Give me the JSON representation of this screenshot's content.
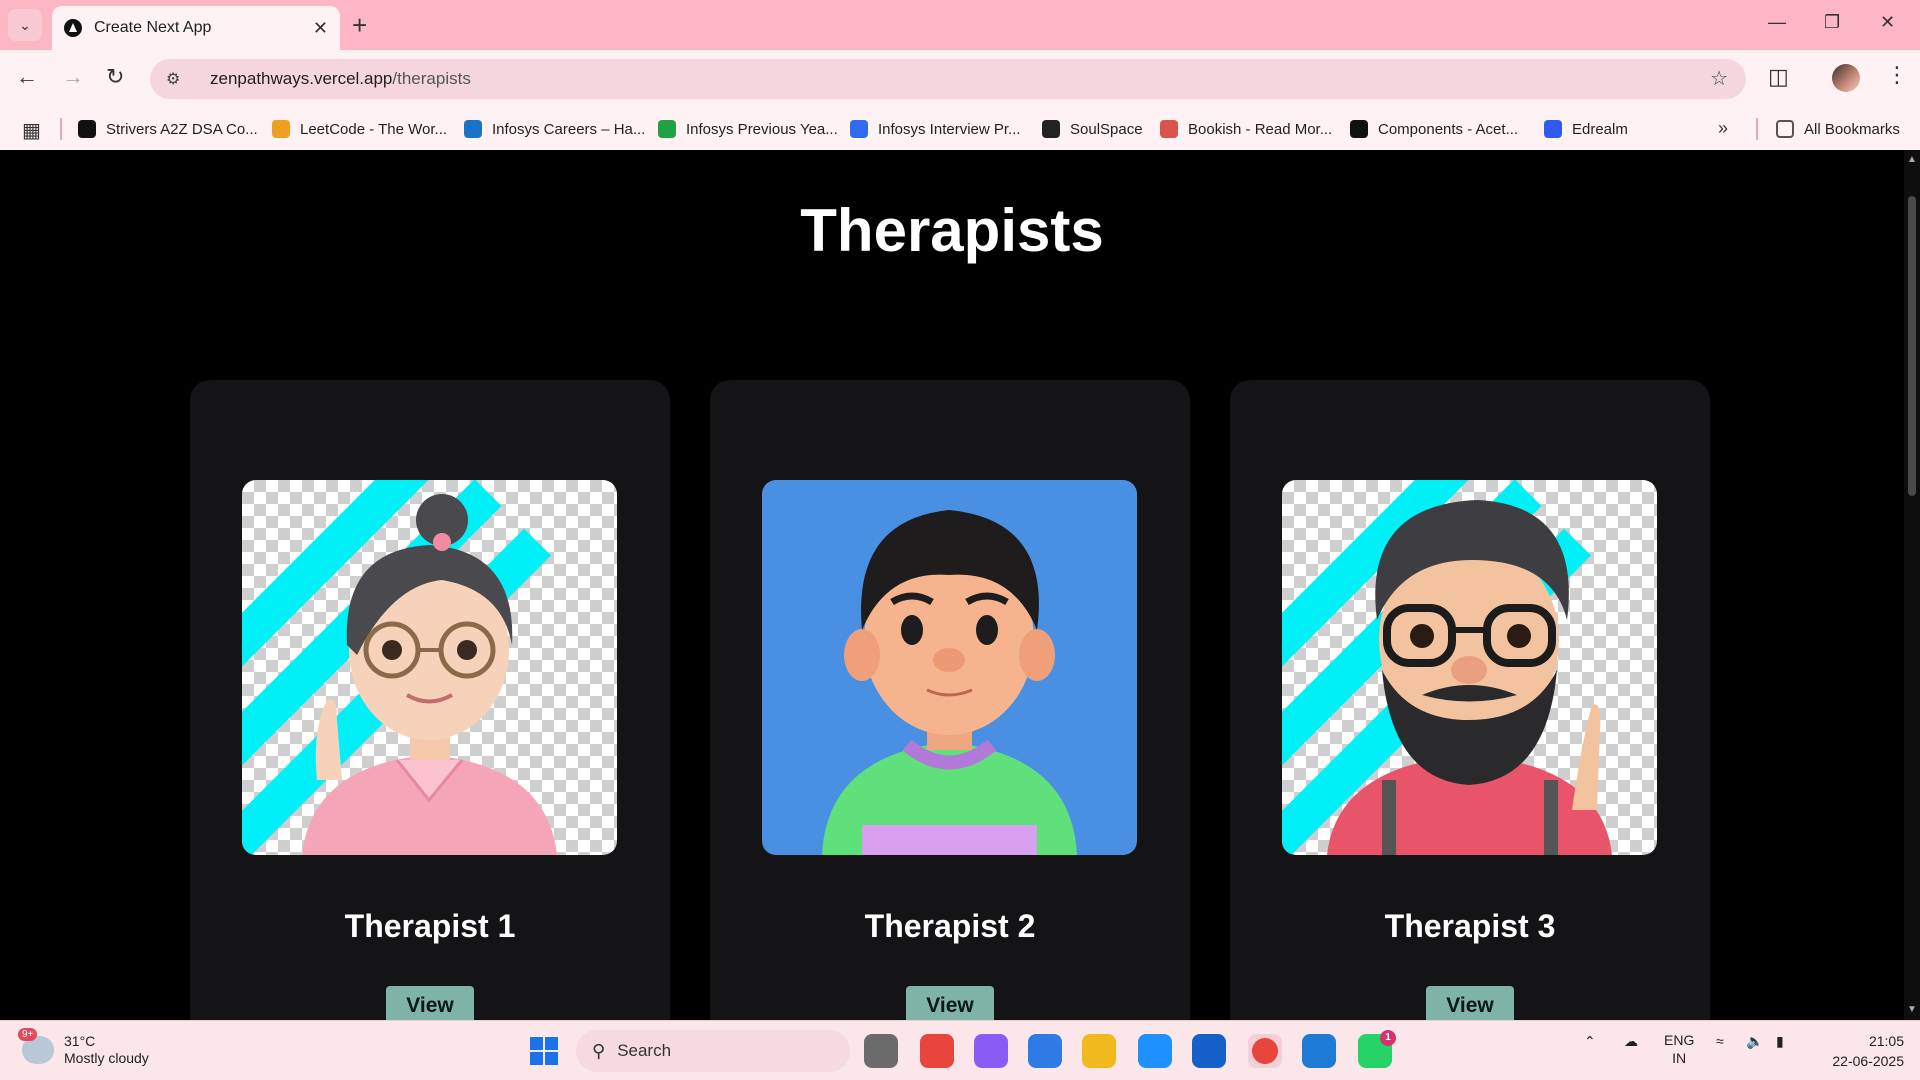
{
  "browser": {
    "tab_title": "Create Next App",
    "url_host": "zenpathways.vercel.app",
    "url_path": "/therapists",
    "bookmarks": [
      {
        "label": "Strivers A2Z DSA Co...",
        "color": "#111111"
      },
      {
        "label": "LeetCode - The Wor...",
        "color": "#f0a020"
      },
      {
        "label": "Infosys Careers – Ha...",
        "color": "#1a73c8"
      },
      {
        "label": "Infosys Previous Yea...",
        "color": "#22a045"
      },
      {
        "label": "Infosys Interview Pr...",
        "color": "#2f6bf0"
      },
      {
        "label": "SoulSpace",
        "color": "#222222"
      },
      {
        "label": "Bookish - Read Mor...",
        "color": "#d9534f"
      },
      {
        "label": "Components - Acet...",
        "color": "#111111"
      },
      {
        "label": "Edrealm",
        "color": "#2f5bf0"
      }
    ],
    "all_bookmarks": "All Bookmarks"
  },
  "page": {
    "title": "Therapists",
    "therapists": [
      {
        "name": "Therapist 1",
        "button": "View",
        "avatar": "female-glasses-avatar",
        "background": "transparent-checker-with-cyan-stripes"
      },
      {
        "name": "Therapist 2",
        "button": "View",
        "avatar": "male-hoodie-avatar",
        "background": "#4a90e2"
      },
      {
        "name": "Therapist 3",
        "button": "View",
        "avatar": "bearded-glasses-avatar",
        "background": "transparent-checker-with-cyan-stripes"
      }
    ]
  },
  "taskbar": {
    "weather_badge": "9+",
    "temperature": "31°C",
    "condition": "Mostly cloudy",
    "search_label": "Search",
    "lang_1": "ENG",
    "lang_2": "IN",
    "time": "21:05",
    "date": "22-06-2025",
    "whatsapp_badge": "1"
  },
  "colors": {
    "chrome_pink": "#fdb7c4",
    "card_bg": "#141416",
    "view_button": "#7fb3a8",
    "stripe_cyan": "#00f0f8"
  }
}
